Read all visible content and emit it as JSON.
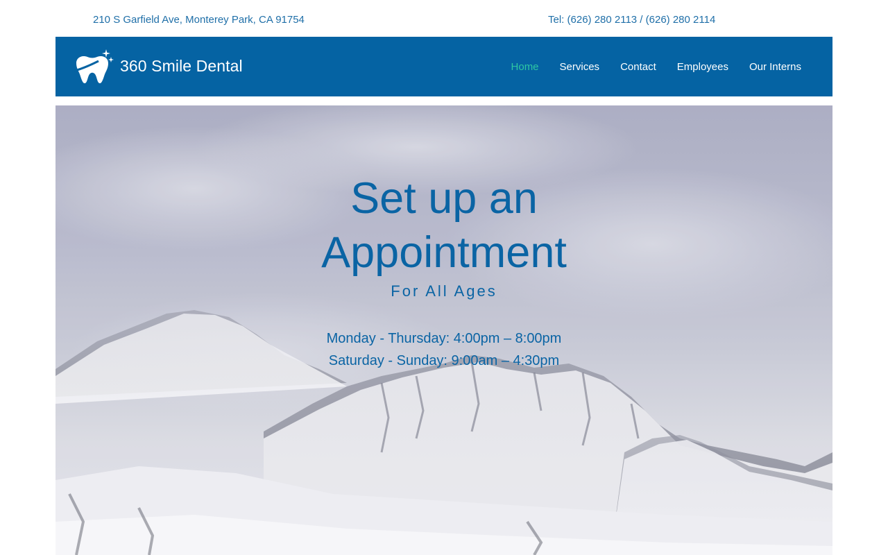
{
  "topbar": {
    "address": "210 S Garfield Ave, Monterey Park, CA 91754",
    "phone": "Tel: (626) 280 2113 / (626) 280 2114"
  },
  "header": {
    "brand_name": "360 Smile Dental",
    "logo_icon": "tooth-sparkle-icon",
    "nav": {
      "home": "Home",
      "services": "Services",
      "contact": "Contact",
      "employees": "Employees",
      "interns": "Our Interns"
    },
    "active_nav": "Home"
  },
  "hero": {
    "title_line1": "Set up an",
    "title_line2": "Appointment",
    "subtitle": "For All Ages",
    "hours": {
      "weekdays": "Monday - Thursday: 4:00pm – 8:00pm",
      "weekend": "Saturday - Sunday: 9:00am – 4:30pm"
    },
    "background": "snowy-mountains-photo"
  },
  "colors": {
    "nav_background": "#0563a3",
    "active_link": "#2ec7a3",
    "text_blue": "#0a64a4",
    "topbar_text": "#1f6fa8"
  }
}
